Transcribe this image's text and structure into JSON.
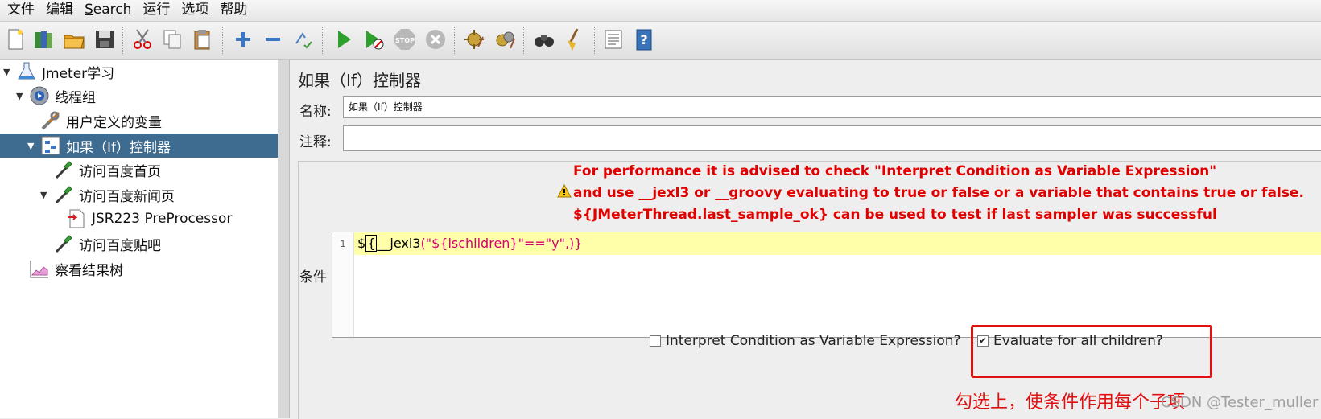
{
  "menu": [
    "文件",
    "编辑",
    "Search",
    "运行",
    "选项",
    "帮助"
  ],
  "toolbar": {
    "icons": [
      "new-icon",
      "templates-icon",
      "open-icon",
      "save-icon",
      "cut-icon",
      "copy-icon",
      "paste-icon",
      "expand-icon",
      "collapse-icon",
      "toggle-icon",
      "start-icon",
      "start-no-pause-icon",
      "stop-icon",
      "shutdown-icon",
      "clear-icon",
      "clear-all-icon",
      "search-icon",
      "reset-search-icon",
      "function-helper-icon",
      "help-icon"
    ]
  },
  "tree": [
    {
      "label": "Jmeter学习",
      "icon": "flask-icon",
      "expanded": true
    },
    {
      "label": "线程组",
      "icon": "gear-icon",
      "expanded": true
    },
    {
      "label": "用户定义的变量",
      "icon": "wrench-icon",
      "expanded": null
    },
    {
      "label": "如果（If）控制器",
      "icon": "if-controller-icon",
      "expanded": true,
      "selected": true
    },
    {
      "label": "访问百度首页",
      "icon": "pipette-icon",
      "expanded": null
    },
    {
      "label": "访问百度新闻页",
      "icon": "pipette-icon",
      "expanded": true
    },
    {
      "label": "JSR223 PreProcessor",
      "icon": "preprocessor-icon",
      "expanded": null
    },
    {
      "label": "访问百度贴吧",
      "icon": "pipette-icon",
      "expanded": null
    },
    {
      "label": "察看结果树",
      "icon": "chart-icon",
      "expanded": null
    }
  ],
  "panel": {
    "title": "如果（If）控制器",
    "name_label": "名称:",
    "name_value": "如果（If）控制器",
    "comment_label": "注释:",
    "comment_value": "",
    "warning_lines": [
      "For performance it is advised to check \"Interpret Condition as Variable Expression\"",
      "and use __jexl3 or __groovy evaluating to true or false or a variable that contains true or false.",
      "${JMeterThread.last_sample_ok} can be used to test if last sampler was successful"
    ],
    "condition_label": "条件",
    "code_line_number": "1",
    "code_prefix": "$",
    "code_caret": "{",
    "code_func": "__jexl3",
    "code_args": "(\"${ischildren}\"==\"y\",)}",
    "interpret_label": "Interpret Condition as Variable Expression?",
    "interpret_checked": false,
    "evaluate_label": "Evaluate for all children?",
    "evaluate_checked": true
  },
  "annotation": {
    "note": "勾选上，使条件作用每个子项",
    "color": "#e01010"
  },
  "watermark": "CSDN @Tester_muller",
  "colors": {
    "selection": "#3e6b90",
    "warning": "#e00000",
    "editor_highlight": "#ffffaa",
    "string_token": "#d4006f"
  }
}
